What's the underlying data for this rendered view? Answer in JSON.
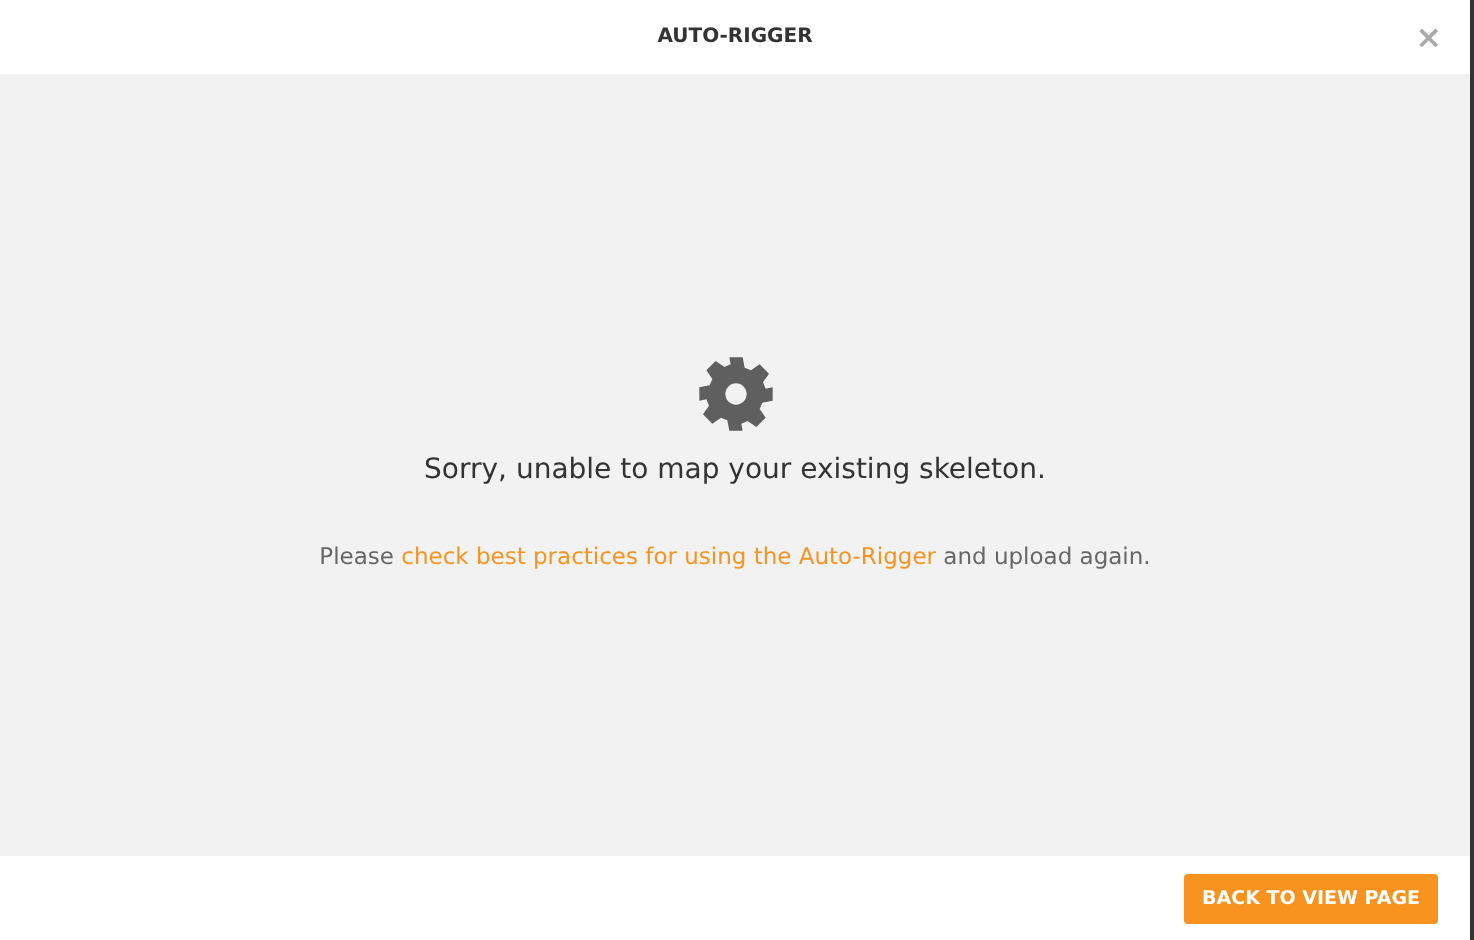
{
  "window": {
    "title": "AUTO-RIGGER",
    "close": "×"
  },
  "message": {
    "heading": "Sorry, unable to map your existing skeleton.",
    "before": "Please ",
    "link": "check best practices for using the Auto-Rigger",
    "after": " and upload again."
  },
  "footer": {
    "button": "BACK TO VIEW PAGE"
  }
}
